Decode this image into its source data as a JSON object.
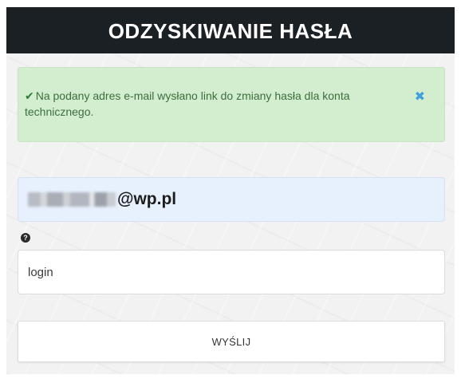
{
  "header": {
    "title": "ODZYSKIWANIE HASŁA"
  },
  "alert": {
    "icon": "check-icon",
    "message": "Na podany adres e-mail wysłano link do zmiany hasła dla konta technicznego.",
    "close_icon": "close-icon",
    "colors": {
      "background": "#d3eecf",
      "text": "#3c6e3e",
      "close": "#3fa0dd"
    }
  },
  "form": {
    "email_domain": "@wp.pl",
    "help_icon": "question-circle-icon",
    "login_placeholder": "login",
    "submit_label": "WYŚLIJ"
  },
  "colors": {
    "header_bg": "#1b2025",
    "email_field_bg": "#e7f0fd"
  }
}
